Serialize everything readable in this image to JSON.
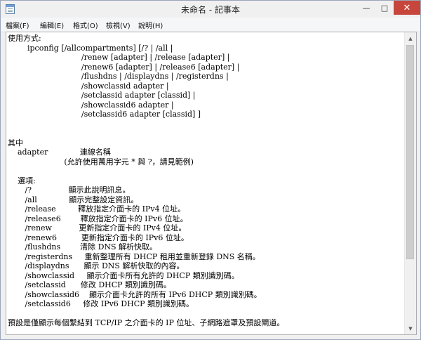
{
  "window": {
    "title": "未命名 - 記事本",
    "minimize_glyph": "—",
    "maximize_glyph": "□",
    "close_glyph": "✕",
    "icon": "notepad-icon",
    "close_color": "#c7463b"
  },
  "menu": {
    "items": [
      {
        "label": "檔案(F)"
      },
      {
        "label": "編輯(E)"
      },
      {
        "label": "格式(O)"
      },
      {
        "label": "檢視(V)"
      },
      {
        "label": "說明(H)"
      }
    ]
  },
  "editor": {
    "lines": [
      "使用方式:",
      "        ipconfig [/allcompartments] [/? | /all |",
      "                              /renew [adapter] | /release [adapter] |",
      "                              /renew6 [adapter] | /release6 [adapter] |",
      "                              /flushdns | /displaydns | /registerdns |",
      "                              /showclassid adapter |",
      "                              /setclassid adapter [classid] |",
      "                              /showclassid6 adapter |",
      "                              /setclassid6 adapter [classid] ]",
      "",
      "",
      "其中",
      "    adapter             連線名稱",
      "                       (允許使用萬用字元 * 與 ?，請見範例)",
      "",
      "    選項:",
      "       /?               顯示此說明訊息。",
      "       /all             顯示完整設定資訊。",
      "       /release         釋放指定介面卡的 IPv4 位址。",
      "       /release6        釋放指定介面卡的 IPv6 位址。",
      "       /renew           更新指定介面卡的 IPv4 位址。",
      "       /renew6          更新指定介面卡的 IPv6 位址。",
      "       /flushdns        清除 DNS 解析快取。",
      "       /registerdns     重新整理所有 DHCP 租用並重新登錄 DNS 名稱。",
      "       /displaydns      顯示 DNS 解析快取的內容。",
      "       /showclassid     顯示介面卡所有允許的 DHCP 類別識別碼。",
      "       /setclassid      修改 DHCP 類別識別碼。",
      "       /showclassid6    顯示介面卡允許的所有 IPv6 DHCP 類別識別碼。",
      "       /setclassid6     修改 IPv6 DHCP 類別識別碼。",
      "",
      "預設是僅顯示每個繫結到 TCP/IP 之介面卡的 IP 位址、子網路遮罩及預設閘道。"
    ]
  },
  "scrollbar": {
    "up_glyph": "▲",
    "down_glyph": "▼"
  }
}
